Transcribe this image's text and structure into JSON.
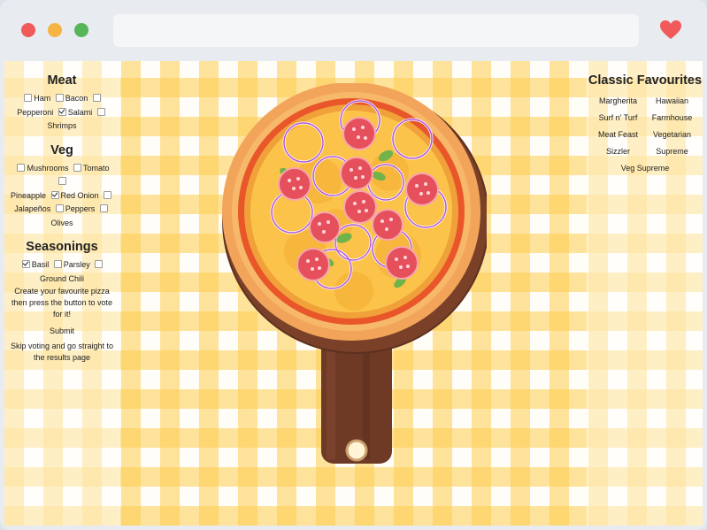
{
  "browser": {
    "heart_icon": "heart-icon",
    "accent": "#f15a5a"
  },
  "left_panel": {
    "meat": {
      "title": "Meat",
      "options": [
        {
          "label": "Ham",
          "checked": false
        },
        {
          "label": "Bacon",
          "checked": false
        },
        {
          "label": "Pepperoni",
          "checked": false
        },
        {
          "label": "Salami",
          "checked": true
        },
        {
          "label": "Shrimps",
          "checked": false
        }
      ]
    },
    "veg": {
      "title": "Veg",
      "options": [
        {
          "label": "Mushrooms",
          "checked": false
        },
        {
          "label": "Tomato",
          "checked": false
        },
        {
          "label": "Pineapple",
          "checked": false
        },
        {
          "label": "Red Onion",
          "checked": true
        },
        {
          "label": "Jalapeños",
          "checked": false
        },
        {
          "label": "Peppers",
          "checked": false
        },
        {
          "label": "Olives",
          "checked": false
        }
      ]
    },
    "seasonings": {
      "title": "Seasonings",
      "options": [
        {
          "label": "Basil",
          "checked": true
        },
        {
          "label": "Parsley",
          "checked": false
        },
        {
          "label": "Ground Chili",
          "checked": false
        }
      ]
    },
    "create_note": "Create your favourite pizza then press the button to vote for it!",
    "submit_label": "Submit",
    "skip_note": "Skip voting and go straight to the results page"
  },
  "right_panel": {
    "title": "Classic Favourites",
    "items": [
      "Margherita",
      "Hawaiian",
      "Surf n' Turf",
      "Farmhouse",
      "Meat Feast",
      "Vegetarian",
      "Sizzler",
      "Supreme",
      "Veg Supreme"
    ]
  }
}
